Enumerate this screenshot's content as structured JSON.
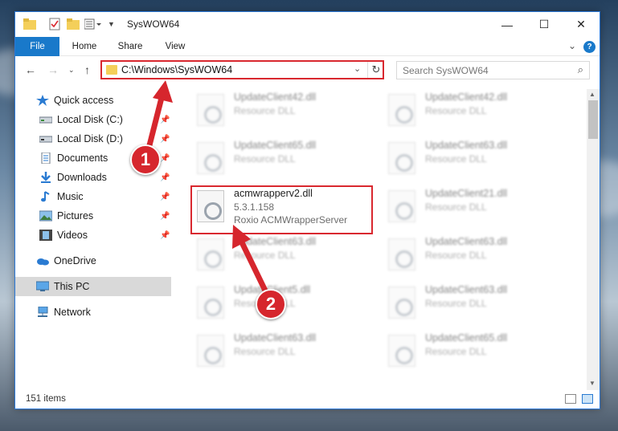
{
  "window": {
    "title": "SysWOW64"
  },
  "ribbon": {
    "tabs": [
      {
        "label": "File"
      },
      {
        "label": "Home"
      },
      {
        "label": "Share"
      },
      {
        "label": "View"
      }
    ],
    "help_label": "?"
  },
  "address_bar": {
    "path": "C:\\Windows\\SysWOW64"
  },
  "search": {
    "placeholder": "Search SysWOW64"
  },
  "sidebar": {
    "items": [
      {
        "label": "Quick access",
        "icon": "star-icon"
      },
      {
        "label": "Local Disk (C:)",
        "icon": "drive-icon"
      },
      {
        "label": "Local Disk (D:)",
        "icon": "drive-icon"
      },
      {
        "label": "Documents",
        "icon": "documents-icon"
      },
      {
        "label": "Downloads",
        "icon": "download-icon"
      },
      {
        "label": "Music",
        "icon": "music-icon"
      },
      {
        "label": "Pictures",
        "icon": "pictures-icon"
      },
      {
        "label": "Videos",
        "icon": "videos-icon"
      },
      {
        "label": "OneDrive",
        "icon": "cloud-icon"
      },
      {
        "label": "This PC",
        "icon": "computer-icon"
      },
      {
        "label": "Network",
        "icon": "network-icon"
      }
    ]
  },
  "files": {
    "left": [
      {
        "name": "UpdateClient42.dll",
        "desc": "Resource DLL"
      },
      {
        "name": "UpdateClient65.dll",
        "desc": "Resource DLL"
      },
      {
        "name": "acmwrapperv2.dll",
        "version": "5.3.1.158",
        "desc": "Roxio ACMWrapperServer"
      },
      {
        "name": "UpdateClient63.dll",
        "desc": "Resource DLL"
      },
      {
        "name": "UpdateClient5.dll",
        "desc": "Resource DLL"
      },
      {
        "name": "UpdateClient63.dll",
        "desc": "Resource DLL"
      }
    ],
    "right": [
      {
        "name": "UpdateClient42.dll",
        "desc": "Resource DLL"
      },
      {
        "name": "UpdateClient63.dll",
        "desc": "Resource DLL"
      },
      {
        "name": "UpdateClient21.dll",
        "desc": "Resource DLL"
      },
      {
        "name": "UpdateClient63.dll",
        "desc": "Resource DLL"
      },
      {
        "name": "UpdateClient63.dll",
        "desc": "Resource DLL"
      },
      {
        "name": "UpdateClient65.dll",
        "desc": "Resource DLL"
      }
    ]
  },
  "status": {
    "item_count": "151 items"
  },
  "annotations": {
    "step1": "1",
    "step2": "2"
  },
  "colors": {
    "accent": "#1979ca",
    "highlight": "#d9282f",
    "folder": "#f4cf5a"
  }
}
